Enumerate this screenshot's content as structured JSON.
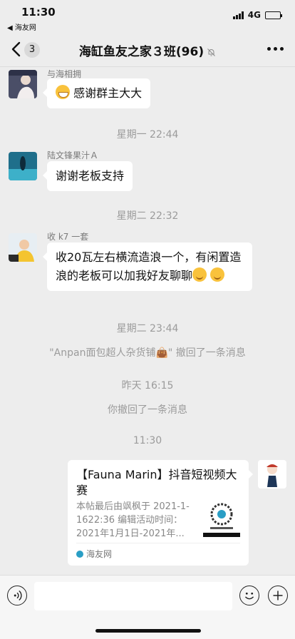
{
  "status_bar": {
    "time": "11:30",
    "back_app": "◀ 海友网",
    "network": "4G",
    "battery_level": 0.45
  },
  "nav": {
    "unread_count": "3",
    "title": "海缸鱼友之家３班(96)"
  },
  "messages": [
    {
      "sender": "与海相拥",
      "text": "感谢群主大大",
      "emoji_before": "grin"
    },
    {
      "sender": "陆文锋果汁Ａ",
      "text": "谢谢老板支持"
    },
    {
      "sender": "收 k7 一套",
      "text": "收20瓦左右横流造浪一个，有闲置造浪的老板可以加我好友聊聊",
      "emoji_after": "smirk"
    }
  ],
  "system": {
    "t1": "星期一 22:44",
    "t2": "星期二 22:32",
    "t3": "星期二 23:44",
    "recall_other": "\"Anpan面包超人杂货铺👜\" 撤回了一条消息",
    "t4": "昨天 16:15",
    "recall_self": "你撤回了一条消息",
    "t5": "11:30"
  },
  "card": {
    "title": "【Fauna Marin】抖音短视频大赛",
    "desc": "本帖最后由飒枫于 2021-1-1622:36 编辑活动时间：2021年1月1日-2021年...",
    "source": "海友网"
  },
  "colors": {
    "bubble": "#ffffff",
    "background": "#ededed",
    "system_text": "#9b9b9b"
  }
}
